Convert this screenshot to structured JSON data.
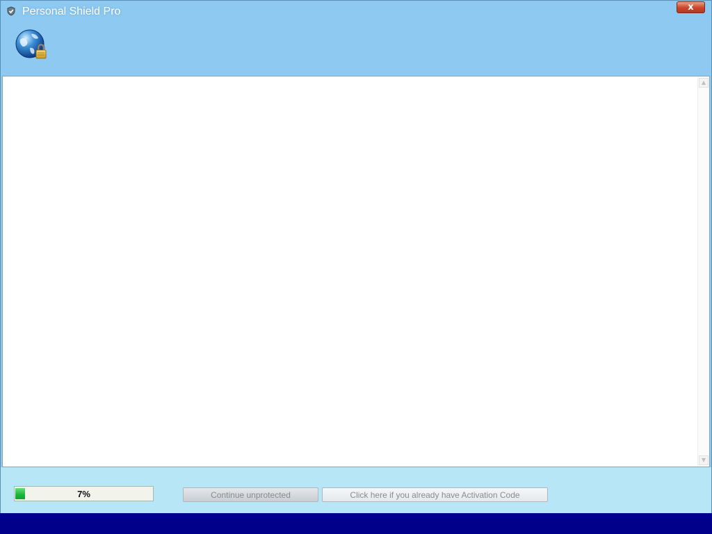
{
  "window": {
    "title": "Personal Shield Pro",
    "close_label": "x"
  },
  "progress": {
    "value_percent": 7,
    "label": "7%"
  },
  "buttons": {
    "continue_label": "Continue unprotected",
    "activation_label": "Click here if you already have Activation Code"
  },
  "icons": {
    "title": "shield-icon",
    "header": "globe-lock-icon",
    "scroll_up": "scroll-up-arrow-icon",
    "scroll_down": "scroll-down-arrow-icon"
  },
  "colors": {
    "window_background": "#8dc9f0",
    "footer_background": "#b7e6f7",
    "desktop_background": "#00008b",
    "progress_fill": "#1eb43c",
    "close_button": "#c8462c"
  }
}
